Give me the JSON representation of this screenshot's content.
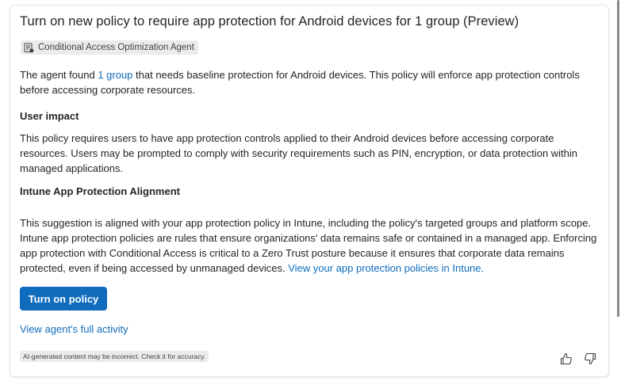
{
  "card": {
    "title": "Turn on new policy to require app protection for Android devices for 1 group (Preview)",
    "agent_badge": "Conditional Access Optimization Agent",
    "summary": {
      "before": "The agent found ",
      "link": "1 group",
      "after": " that needs baseline protection for Android devices. This policy will enforce app protection controls before accessing corporate resources."
    },
    "user_impact": {
      "heading": "User impact",
      "text": "This policy requires users to have app protection controls applied to their Android devices before accessing corporate resources. Users may be prompted to comply with security requirements such as PIN, encryption, or data protection within managed applications."
    },
    "alignment": {
      "heading": "Intune App Protection Alignment",
      "text": "This suggestion is aligned with your app protection policy in Intune, including the policy's targeted groups and platform scope. Intune app protection policies are rules that ensure organizations' data remains safe or contained in a managed app. Enforcing app protection with Conditional Access is critical to a Zero Trust posture because it ensures that corporate data remains protected, even if being accessed by unmanaged devices. ",
      "link": "View your app protection policies in Intune."
    },
    "primary_button": "Turn on policy",
    "activity_link": "View agent's full activity",
    "disclaimer": "AI-generated content may be incorrect. Check it for accuracy."
  },
  "icons": {
    "agent": "agent-icon",
    "thumbs_up": "thumbs-up-icon",
    "thumbs_down": "thumbs-down-icon"
  },
  "colors": {
    "accent": "#0f6cbd",
    "text": "#242424",
    "badge_bg": "#ebebeb"
  }
}
